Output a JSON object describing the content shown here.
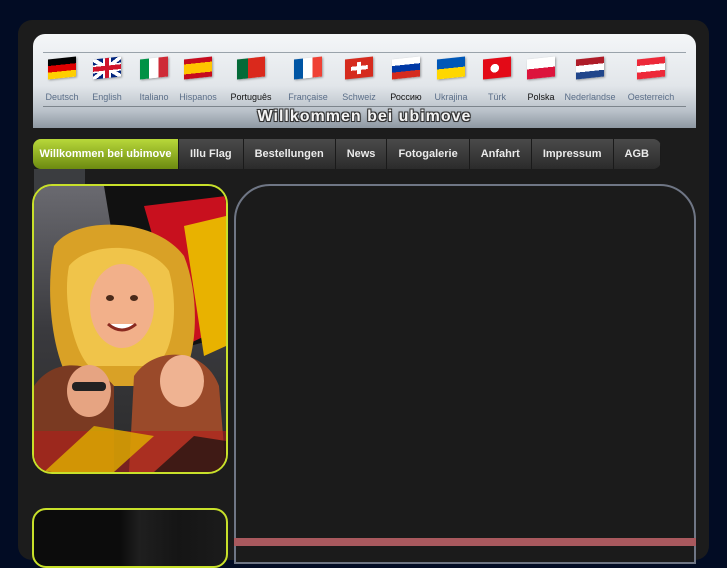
{
  "header": {
    "welcome_text": "Willkommen bei ubimove",
    "languages": [
      {
        "label": "Deutsch",
        "flag": "germany-flag"
      },
      {
        "label": "English",
        "flag": "uk-flag"
      },
      {
        "label": "Italiano",
        "flag": "italy-flag"
      },
      {
        "label": "Hispanos",
        "flag": "spain-flag"
      },
      {
        "label": "Português",
        "flag": "portugal-flag"
      },
      {
        "label": "Française",
        "flag": "france-flag"
      },
      {
        "label": "Schweiz",
        "flag": "switzerland-flag"
      },
      {
        "label": "Россию",
        "flag": "russia-flag"
      },
      {
        "label": "Ukrajina",
        "flag": "ukraine-flag"
      },
      {
        "label": "Türk",
        "flag": "turkey-flag"
      },
      {
        "label": "Polska",
        "flag": "poland-flag"
      },
      {
        "label": "Nederlandse",
        "flag": "netherlands-flag"
      },
      {
        "label": "Oesterreich",
        "flag": "austria-flag"
      }
    ]
  },
  "nav": {
    "items": [
      {
        "label": "Willkommen bei ubimove",
        "active": true
      },
      {
        "label": "Illu Flag"
      },
      {
        "label": "Bestellungen"
      },
      {
        "label": "News"
      },
      {
        "label": "Fotogalerie"
      },
      {
        "label": "Anfahrt"
      },
      {
        "label": "Impressum"
      },
      {
        "label": "AGB"
      }
    ]
  },
  "colors": {
    "background": "#020c24",
    "frame": "#1c1c1c",
    "accent_green": "#c8e02a",
    "content_border": "#6f7685",
    "bottom_bar": "#a9595e"
  }
}
